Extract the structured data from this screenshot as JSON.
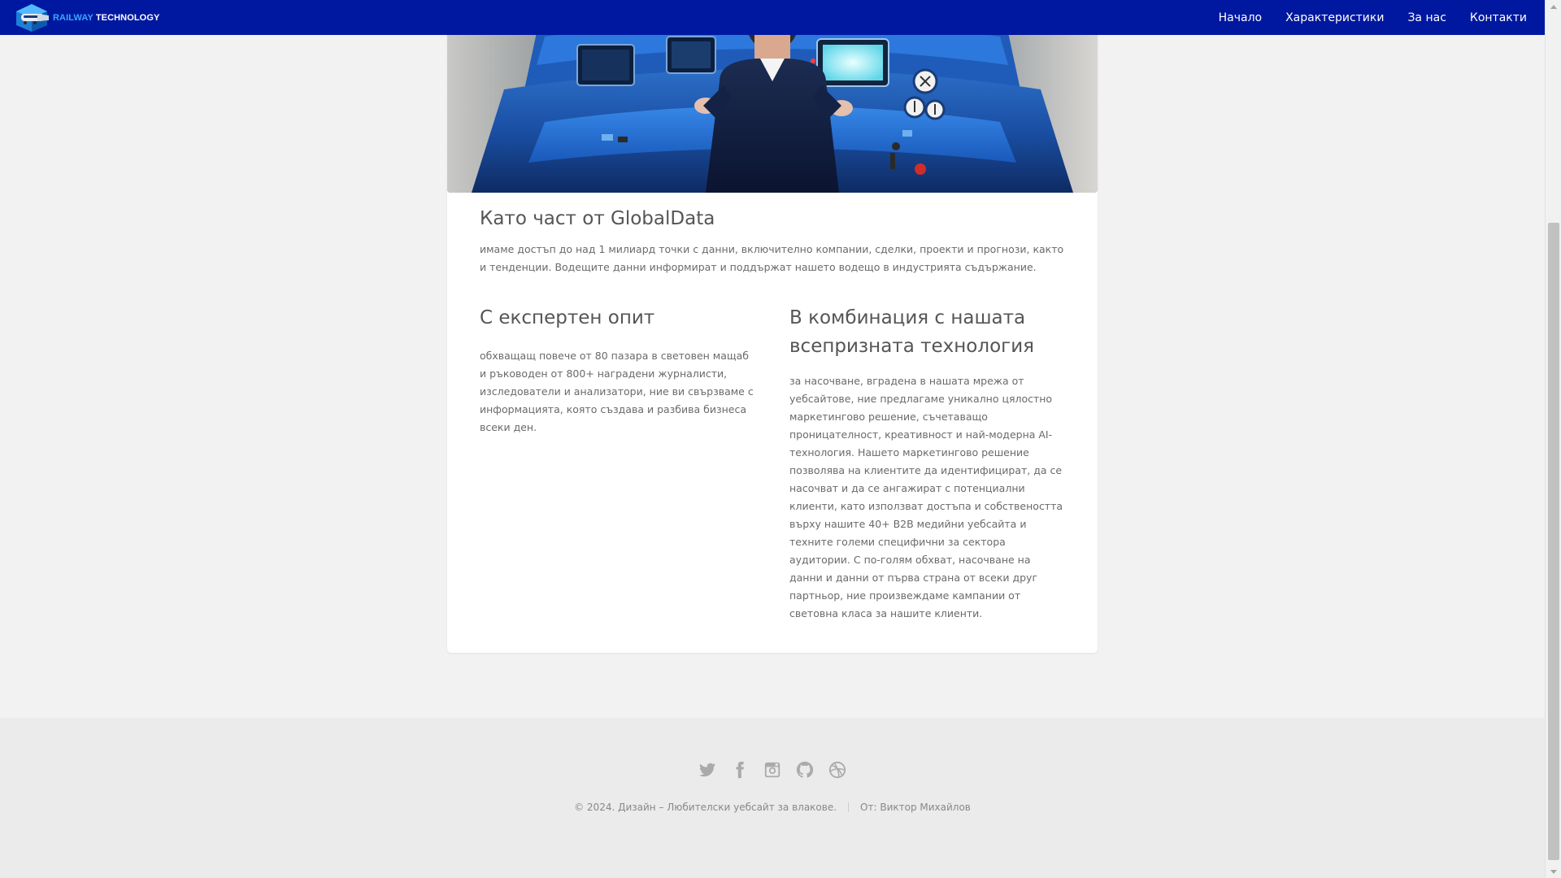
{
  "navbar": {
    "brand_part1": "RAILWAY",
    "brand_part2": "TECHNOLOGY",
    "links": [
      "Начало",
      "Характеристики",
      "За нас",
      "Контакти"
    ]
  },
  "main": {
    "intro_heading": "Като част от GlobalData",
    "intro_text": "имаме достъп до над 1 милиард точки с данни, включително компании, сделки, проекти и прогнози, както и тенденции. Водещите данни информират и поддържат нашето водещо в индустрията съдържание.",
    "col1_heading": "С експертен опит",
    "col1_text": "обхващащ повече от 80 пазара в световен мащаб и ръководен от 800+ наградени журналисти, изследователи и анализатори, ние ви свързваме с информацията, която създава и разбива бизнеса всеки ден.",
    "col2_heading": "В комбинация с нашата всепризната технология",
    "col2_text": "за насочване, вградена в нашата мрежа от уебсайтове, ние предлагаме уникално цялостно маркетингово решение, съчетаващо проницателност, креативност и най-модерна AI-технология. Нашето маркетингово решение позволява на клиентите да идентифицират, да се насочват и да се ангажират с потенциални клиенти, като използват достъпа и собствеността върху нашите 40+ B2B медийни уебсайта и техните големи специфични за сектора аудитории. С по-голям обхват, насочване на данни и данни от първа страна от всеки друг партньор, ние произвеждаме кампании от световна класа за нашите клиенти."
  },
  "footer": {
    "social_icons": [
      "twitter-icon",
      "facebook-icon",
      "instagram-icon",
      "github-icon",
      "dribbble-icon"
    ],
    "copyright": "© 2024. Дизайн – Любителски уебсайт за влакове.",
    "author": "От: Виктор Михайлов"
  },
  "colors": {
    "navbar_bg": "#0018a0",
    "brand_accent": "#3aa7ff",
    "page_bg": "#f2f2f2",
    "footer_bg": "#ebebeb"
  }
}
